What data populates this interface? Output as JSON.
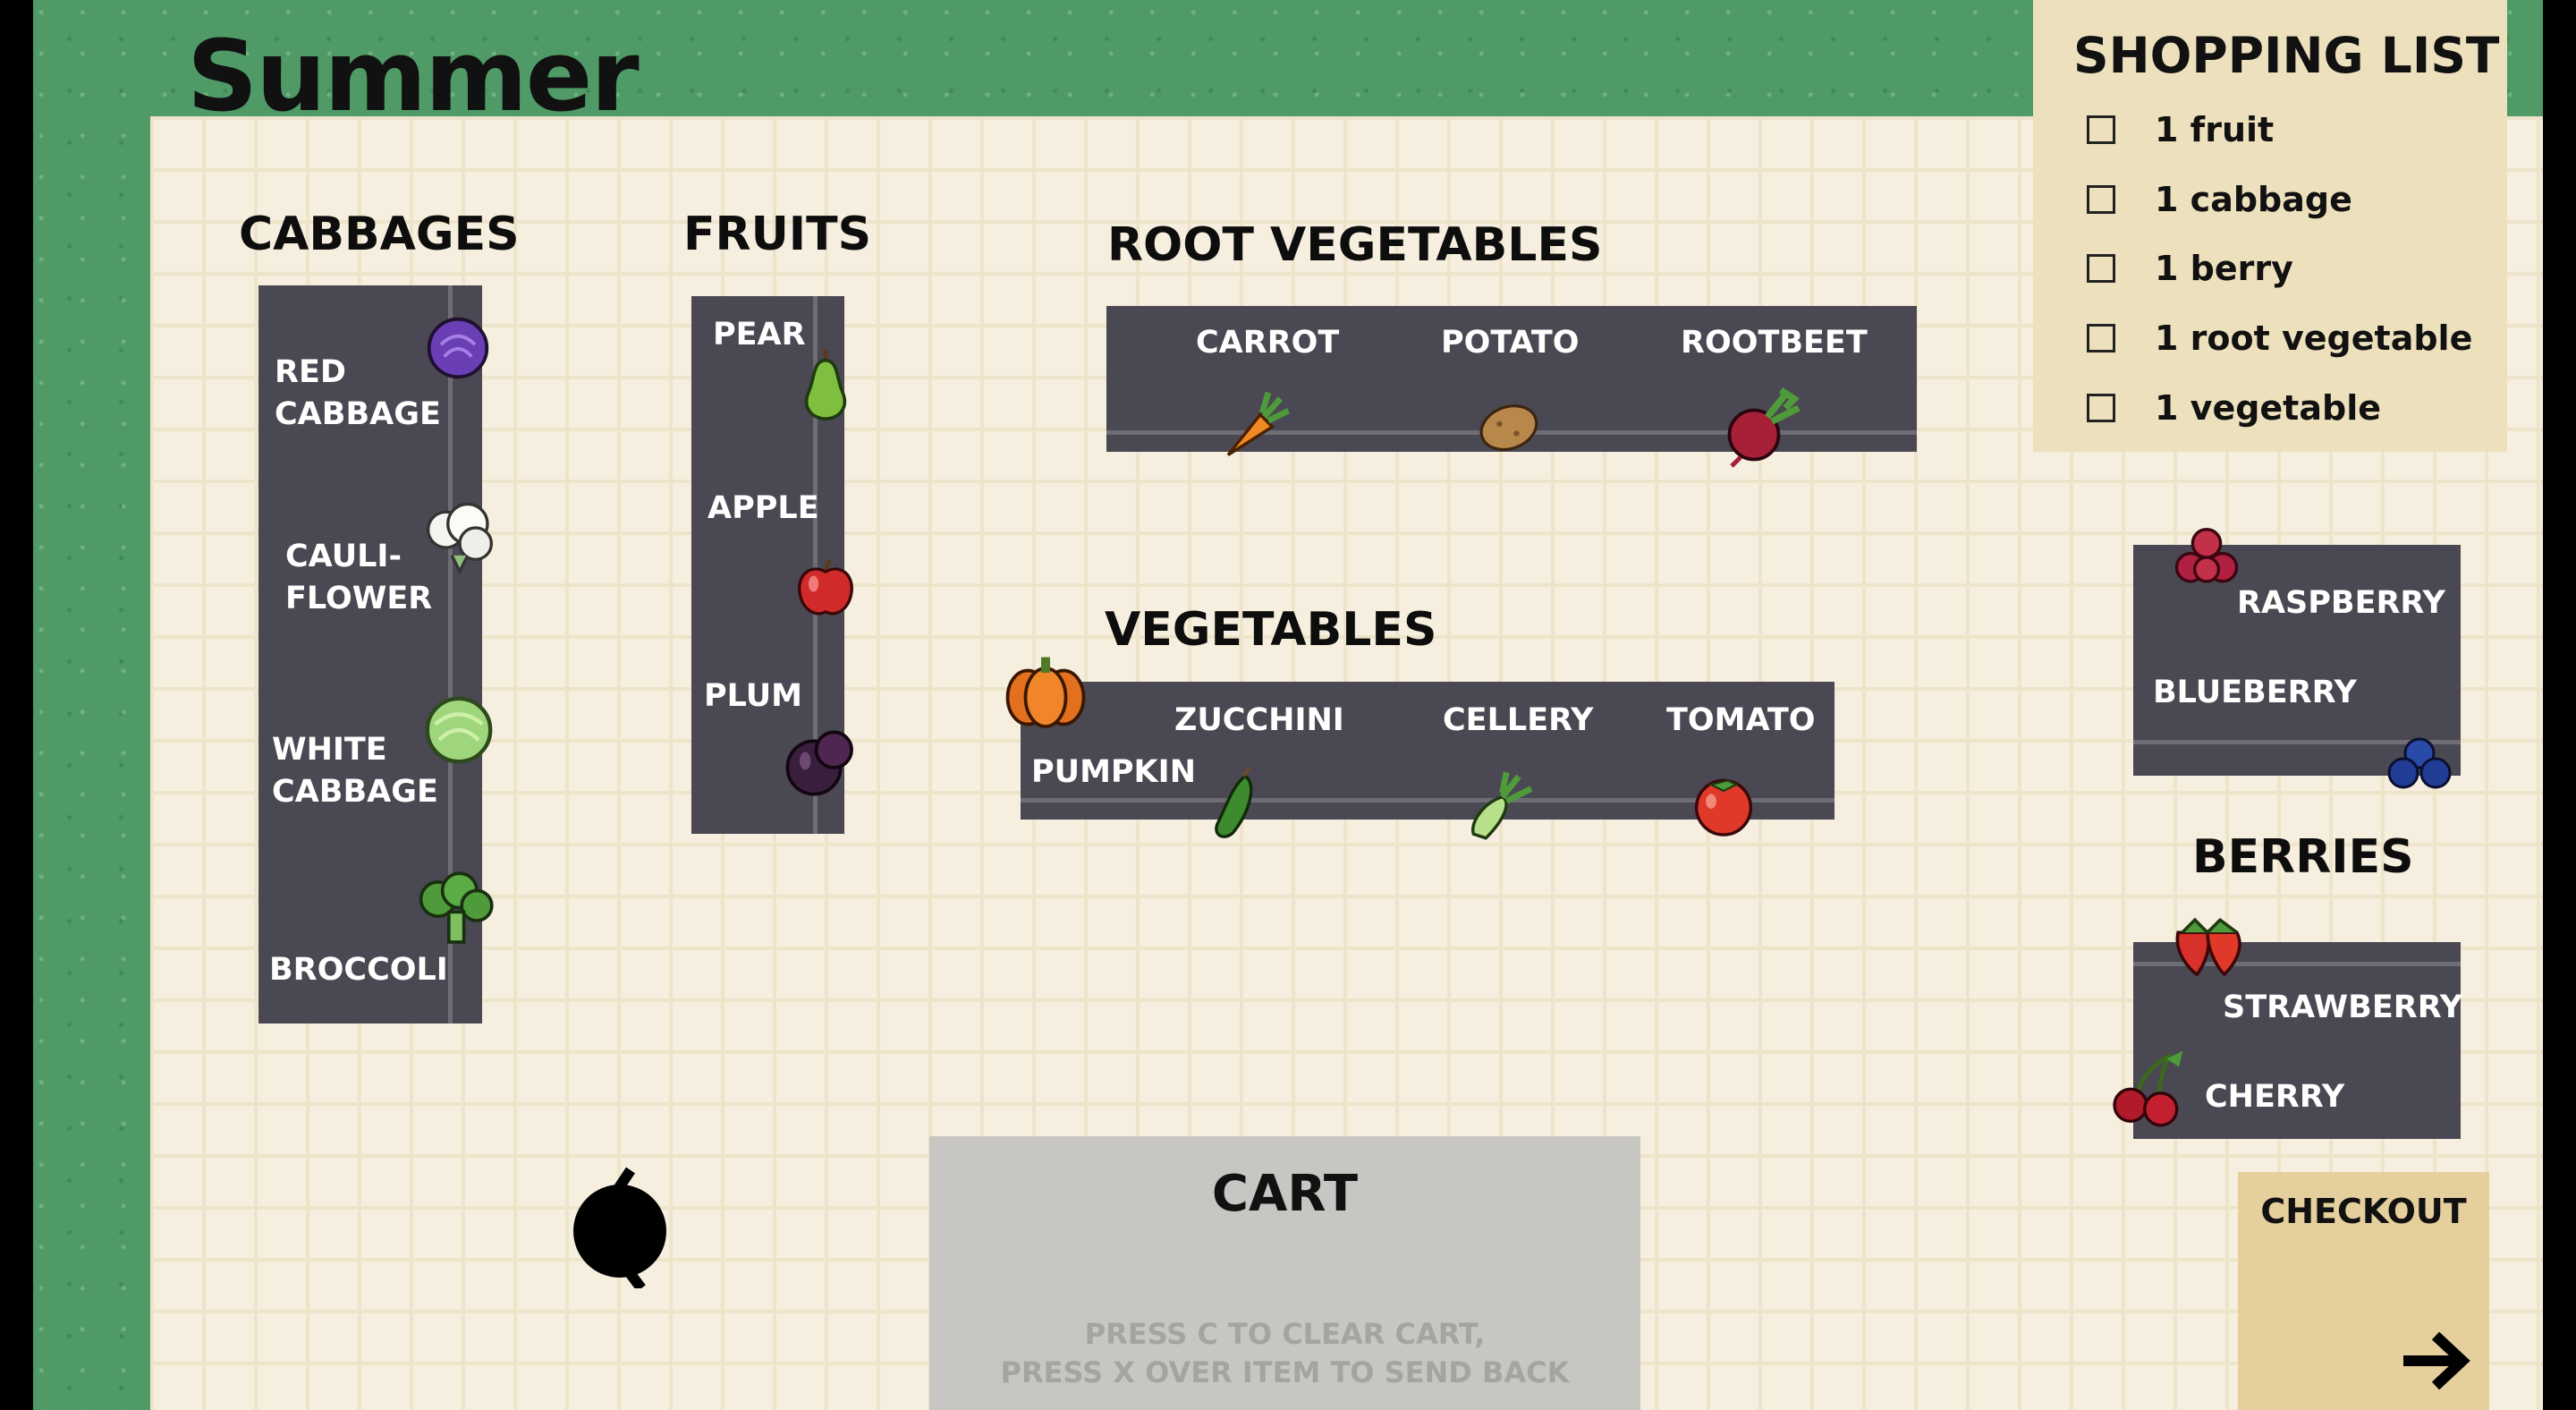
{
  "season": "Summer",
  "sections": {
    "cabbages": "CABBAGES",
    "fruits": "FRUITS",
    "root_vegetables": "ROOT VEGETABLES",
    "vegetables": "VEGETABLES",
    "berries": "BERRIES"
  },
  "cabbages": [
    "RED\nCABBAGE",
    "CAULI-\nFLOWER",
    "WHITE\nCABBAGE",
    "BROCCOLI"
  ],
  "fruits": [
    "PEAR",
    "APPLE",
    "PLUM"
  ],
  "root_vegetables": [
    "CARROT",
    "POTATO",
    "ROOTBEET"
  ],
  "vegetables": [
    "PUMPKIN",
    "ZUCCHINI",
    "CELLERY",
    "TOMATO"
  ],
  "berries_top": [
    "RASPBERRY",
    "BLUEBERRY"
  ],
  "berries_bottom": [
    "STRAWBERRY",
    "CHERRY"
  ],
  "shopping_list": {
    "title": "SHOPPING LIST",
    "items": [
      {
        "label": "1 fruit",
        "checked": false
      },
      {
        "label": "1 cabbage",
        "checked": false
      },
      {
        "label": "1 berry",
        "checked": false
      },
      {
        "label": "1 root vegetable",
        "checked": false
      },
      {
        "label": "1 vegetable",
        "checked": false
      }
    ]
  },
  "cart": {
    "title": "CART",
    "hint": "PRESS C TO CLEAR CART,\nPRESS X OVER ITEM TO SEND BACK"
  },
  "checkout": {
    "label": "CHECKOUT"
  },
  "icons": {
    "red_cabbage": "red-cabbage-icon",
    "cauliflower": "cauliflower-icon",
    "white_cabbage": "white-cabbage-icon",
    "broccoli": "broccoli-icon",
    "pear": "pear-icon",
    "apple": "apple-icon",
    "plum": "plum-icon",
    "carrot": "carrot-icon",
    "potato": "potato-icon",
    "rootbeet": "beet-icon",
    "pumpkin": "pumpkin-icon",
    "zucchini": "zucchini-icon",
    "cellery": "celery-icon",
    "tomato": "tomato-icon",
    "raspberry": "raspberry-icon",
    "blueberry": "blueberry-icon",
    "strawberry": "strawberry-icon",
    "cherry": "cherry-icon",
    "player": "player-character-icon",
    "checkout_arrow": "arrow-right-icon"
  },
  "colors": {
    "grass": "#4f9a66",
    "floor": "#f6efdf",
    "shelf": "#4a4852",
    "shopping_list_bg": "#ede0bd",
    "cart_bg": "#c7c6c2",
    "checkout_bg": "#e5cf9d"
  }
}
